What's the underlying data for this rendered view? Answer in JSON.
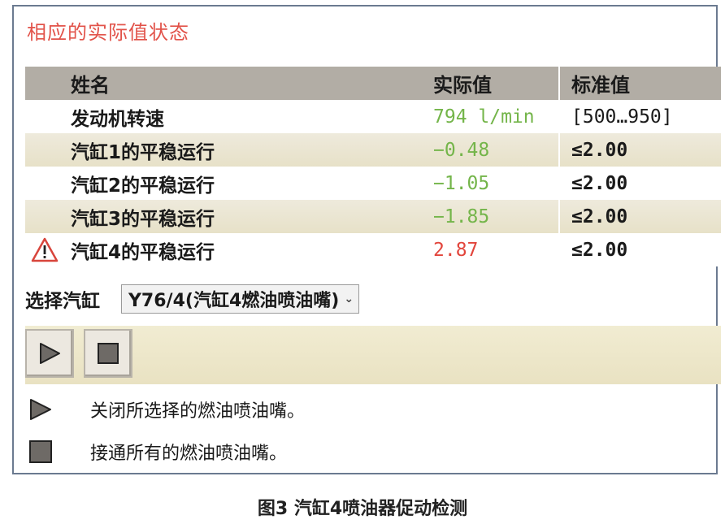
{
  "panel": {
    "title": "相应的实际值状态"
  },
  "table": {
    "headers": {
      "name": "姓名",
      "actual": "实际值",
      "standard": "标准值"
    },
    "rows": [
      {
        "name": "发动机转速",
        "actual": "794 l/min",
        "standard": "[500…950]",
        "status": "ok",
        "warning": false
      },
      {
        "name": "汽缸1的平稳运行",
        "actual": "−0.48",
        "standard": "≤2.00",
        "status": "ok",
        "warning": false
      },
      {
        "name": "汽缸2的平稳运行",
        "actual": "−1.05",
        "standard": "≤2.00",
        "status": "ok",
        "warning": false
      },
      {
        "name": "汽缸3的平稳运行",
        "actual": "−1.85",
        "standard": "≤2.00",
        "status": "ok",
        "warning": false
      },
      {
        "name": "汽缸4的平稳运行",
        "actual": "2.87",
        "standard": "≤2.00",
        "status": "fault",
        "warning": true
      }
    ]
  },
  "selector": {
    "label": "选择汽缸",
    "selected": "Y76/4(汽缸4燃油喷油嘴)"
  },
  "toolbar": {
    "play_icon": "play-icon",
    "stop_icon": "stop-icon"
  },
  "legend": [
    {
      "icon": "play-icon",
      "text": "关闭所选择的燃油喷油嘴。"
    },
    {
      "icon": "stop-icon",
      "text": "接通所有的燃油喷油嘴。"
    }
  ],
  "caption": "图3 汽缸4喷油器促动检测",
  "colors": {
    "title": "#e2534a",
    "ok": "#74b54a",
    "fault": "#e2453c",
    "border": "#6b7a90"
  }
}
